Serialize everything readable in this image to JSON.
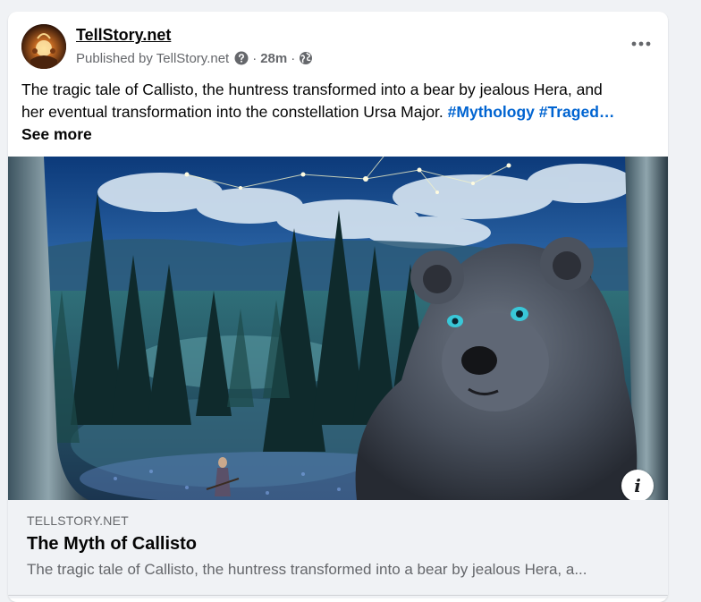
{
  "post": {
    "page_name": "TellStory.net",
    "published_by": "Published by TellStory.net",
    "separator": "·",
    "time": "28m",
    "help_icon": "question-circle-icon",
    "audience_icon": "globe-icon",
    "more_icon": "more-horizontal-icon",
    "text_line1": "The tragic tale of Callisto, the huntress transformed into a bear by jealous Hera, and",
    "text_line2": "her eventual transformation into the constellation Ursa Major.",
    "hashtag1": "#Mythology",
    "hashtag2": "#Traged…",
    "see_more": "See more"
  },
  "image": {
    "description_icon": "info-icon",
    "info_glyph": "i"
  },
  "link_preview": {
    "domain": "TELLSTORY.NET",
    "title": "The Myth of Callisto",
    "description": "The tragic tale of Callisto, the huntress transformed into a bear by jealous Hera, a..."
  }
}
